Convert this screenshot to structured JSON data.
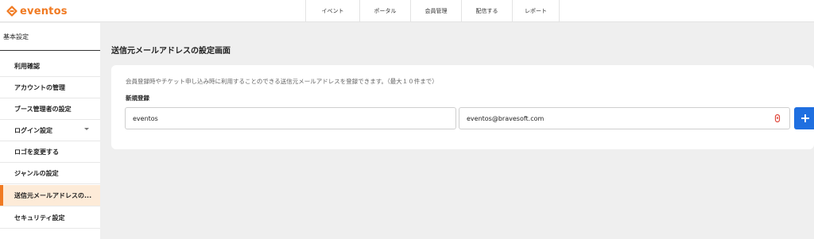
{
  "brand": {
    "name": "eventos",
    "color": "#f07a22",
    "logo_icon": "eventos-logo-icon"
  },
  "nav": {
    "items": [
      {
        "label": "イベント"
      },
      {
        "label": "ポータル"
      },
      {
        "label": "会員管理"
      },
      {
        "label": "配信する"
      },
      {
        "label": "レポート"
      }
    ]
  },
  "sidebar": {
    "header": "基本設定",
    "active_index": 6,
    "accent": "#f07a22",
    "items": [
      {
        "label": "利用確認"
      },
      {
        "label": "アカウントの管理"
      },
      {
        "label": "ブース管理者の設定"
      },
      {
        "label": "ログイン設定",
        "icon": "chevron-down-icon"
      },
      {
        "label": "ロゴを変更する"
      },
      {
        "label": "ジャンルの設定"
      },
      {
        "label": "送信元メールアドレスの..."
      },
      {
        "label": "セキュリティ設定"
      }
    ]
  },
  "main": {
    "title": "送信元メールアドレスの設定画面",
    "description": "会員登録時やチケット申し込み時に利用することのできる送信元メールアドレスを登録できます。（最大１０件まで）",
    "subtitle": "新規登録",
    "name_value": "eventos",
    "email_value": "eventos@bravesoft.com",
    "email_icon": "password-manager-icon",
    "add_button_icon": "plus-icon",
    "add_button_color": "#1f6fe0"
  }
}
